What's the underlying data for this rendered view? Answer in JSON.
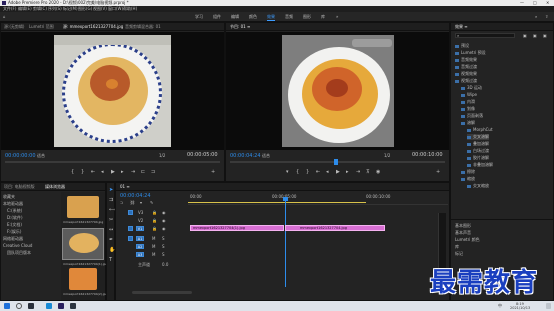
{
  "window": {
    "title": "Adobe Premiere Pro 2020 - D:\\视频\\002\\完美\\电脑视频.prproj *",
    "controls": [
      "—",
      "□",
      "✕"
    ]
  },
  "menu": [
    "文件(F)",
    "编辑(E)",
    "剪辑(C)",
    "序列(S)",
    "标记(M)",
    "图形(G)",
    "视图(V)",
    "窗口(W)",
    "帮助(H)"
  ],
  "workspaces": {
    "items": [
      "学习",
      "组件",
      "编辑",
      "颜色",
      "效果",
      "音频",
      "图形",
      "库"
    ],
    "active": "效果"
  },
  "source_monitor": {
    "tabs": [
      "源:(无剪辑)",
      "Lumetri 范围",
      "源: mmexport1621327704.jpg",
      "音频剪辑混合器: 01"
    ],
    "timecode_left": "00:00:00:00",
    "fit": "适合",
    "scale": "1/2",
    "timecode_right": "00:00:05:00"
  },
  "program_monitor": {
    "tab": "节目: 01 ≡",
    "timecode_left": "00:00:04:24",
    "fit": "适合",
    "scale": "1/2",
    "timecode_right": "00:00:10:00"
  },
  "project": {
    "tabs": [
      "项目: 电脑视频版",
      "媒体浏览器"
    ],
    "active_tab": "媒体浏览器",
    "tree": [
      "收藏夹",
      "本地驱动器",
      "C:(系统)",
      "D:(软件)",
      "E:(文档)",
      "F:(娱乐)",
      "网络驱动器",
      "Creative Cloud",
      "团队项目版本"
    ],
    "thumbs": [
      "mmexport1621327704.jpg",
      "mmexport1621327704(1).jpg",
      "mmexport1621327704(2).jpg"
    ]
  },
  "timeline": {
    "tab": "01 ≡",
    "timecode": "00:00:04:24",
    "ruler": [
      "00:00",
      "00:00:05:00",
      "00:00:10:00"
    ],
    "tracks": [
      "V3",
      "V2",
      "V1",
      "A1",
      "A2",
      "A3",
      "主声道"
    ],
    "master_value": "0.0",
    "clips": [
      {
        "track": "V1",
        "label": "mmexport1621327704(1).jpg"
      },
      {
        "track": "V1",
        "label": "mmexport1621327704.jpg"
      }
    ]
  },
  "effects": {
    "tab": "效果 ≡",
    "items": [
      "预设",
      "Lumetri 预设",
      "音频效果",
      "音频过渡",
      "视频效果",
      "视频过渡",
      "3D 运动",
      "Wipe",
      "内滑",
      "划像",
      "页面剥落",
      "溶解",
      "MorphCut",
      "交叉溶解",
      "叠加溶解",
      "白场过渡",
      "胶片溶解",
      "非叠加溶解",
      "擦除",
      "缩放",
      "交叉缩放"
    ],
    "footer": [
      "基本图形",
      "基本声音",
      "Lumetri 颜色",
      "库",
      "标记"
    ]
  },
  "taskbar": {
    "time": "8:19",
    "date": "2021/10/13",
    "lang": "中"
  },
  "watermark": "最需教育"
}
